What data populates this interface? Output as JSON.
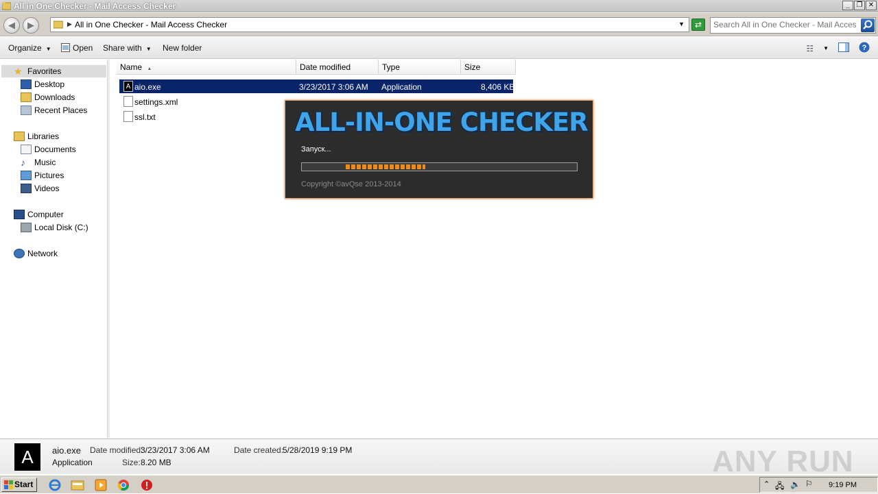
{
  "window": {
    "title": "All in One Checker - Mail Access Checker"
  },
  "address_bar": {
    "path": "All in One Checker - Mail Access Checker",
    "search_placeholder": "Search All in One Checker - Mail Acces..."
  },
  "toolbar": {
    "organize": "Organize",
    "open": "Open",
    "share_with": "Share with",
    "new_folder": "New folder"
  },
  "nav": {
    "favorites": "Favorites",
    "desktop": "Desktop",
    "downloads": "Downloads",
    "recent_places": "Recent Places",
    "libraries": "Libraries",
    "documents": "Documents",
    "music": "Music",
    "pictures": "Pictures",
    "videos": "Videos",
    "computer": "Computer",
    "local_disk": "Local Disk (C:)",
    "network": "Network"
  },
  "columns": {
    "name": "Name",
    "date_modified": "Date modified",
    "type": "Type",
    "size": "Size"
  },
  "files": [
    {
      "name": "aio.exe",
      "date": "3/23/2017 3:06 AM",
      "type": "Application",
      "size": "8,406 KB"
    },
    {
      "name": "settings.xml",
      "date": "",
      "type": "",
      "size": ""
    },
    {
      "name": "ssl.txt",
      "date": "",
      "type": "",
      "size": ""
    }
  ],
  "splash": {
    "logo": "ALL-IN-ONE CHECKER",
    "status": "Запуск...",
    "progress": 0.29,
    "copyright": "Copyright ©avQse  2013-2014"
  },
  "details": {
    "icon_letter": "A",
    "name": "aio.exe",
    "kind": "Application",
    "date_modified_label": "Date modified:",
    "date_modified": "3/23/2017 3:06 AM",
    "size_label": "Size:",
    "size": "8.20 MB",
    "date_created_label": "Date created:",
    "date_created": "5/28/2019 9:19 PM",
    "watermark": "ANY RUN"
  },
  "taskbar": {
    "start": "Start",
    "clock": "9:19 PM"
  },
  "colors": {
    "selection": "#0a246a",
    "progress": "#f08c1a",
    "logo": "#3fa4e8"
  }
}
